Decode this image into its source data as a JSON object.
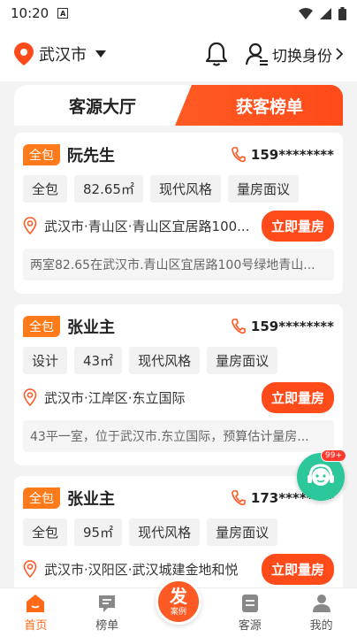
{
  "status_bar": {
    "time": "10:20",
    "a_icon_label": "A"
  },
  "header": {
    "city": "武汉市",
    "switch_label": "切换身份"
  },
  "tabs": {
    "left": "客源大厅",
    "right": "获客榜单"
  },
  "cards": [
    {
      "badge": "全包",
      "name": "阮先生",
      "phone": "159********",
      "tags": [
        "全包",
        "82.65㎡",
        "现代风格",
        "量房面议"
      ],
      "address": "武汉市·青山区·青山区宜居路100...",
      "button": "立即量房",
      "desc": "两室82.65在武汉市.青山区宜居路100号绿地青山..."
    },
    {
      "badge": "全包",
      "name": "张业主",
      "phone": "159********",
      "tags": [
        "设计",
        "43㎡",
        "现代风格",
        "量房面议"
      ],
      "address": "武汉市·江岸区·东立国际",
      "button": "立即量房",
      "desc": "43平一室，位于武汉市.东立国际，预算估计量房..."
    },
    {
      "badge": "全包",
      "name": "张业主",
      "phone": "173********",
      "tags": [
        "全包",
        "95㎡",
        "现代风格",
        "量房面议"
      ],
      "address": "武汉市·汉阳区·武汉城建金地和悦",
      "button": "立即量房",
      "desc": ""
    }
  ],
  "float_badge": "99+",
  "tabbar": {
    "home": "首页",
    "rank": "榜单",
    "fab_big": "发",
    "fab_small": "案例",
    "clients": "客源",
    "mine": "我的"
  },
  "colors": {
    "accent": "#ff5a24",
    "float": "#2cc79b"
  }
}
